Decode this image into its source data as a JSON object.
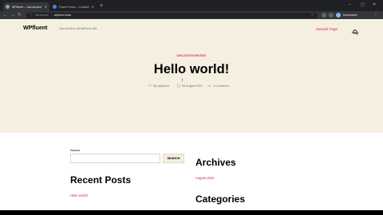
{
  "browser": {
    "tabs": [
      {
        "label": "WPfluent – Just another WordPress",
        "active": true
      },
      {
        "label": "Fluent Forms – Contact Form by WPManageNinja",
        "active": false
      }
    ],
    "new_tab": "+",
    "window_controls": [
      "–",
      "▢",
      "✕"
    ],
    "nav": {
      "back": "←",
      "forward": "→",
      "reload": "↻"
    },
    "address": {
      "secure_label": "Not secure",
      "separator": "|",
      "url": "wpfluent.local"
    },
    "profile_label": "Bookmarks"
  },
  "site": {
    "title": "WPfluent",
    "description": "Just another WordPress site",
    "menu_item": "Sample Page",
    "search_label": "Search"
  },
  "post": {
    "category": "UNCATEGORIZED",
    "title": "Hello world!",
    "author": "By wpfluent",
    "date": "26 August 2021",
    "comments": "1 Comment"
  },
  "widgets": {
    "search_label": "Search",
    "search_value": "",
    "search_button": "SEARCH",
    "recent_posts_heading": "Recent Posts",
    "recent_post_link": "Hello world!",
    "archives_heading": "Archives",
    "archive_link": "August 2021",
    "categories_heading": "Categories"
  },
  "colors": {
    "accent": "#cd2653",
    "hero_bg": "#f5efe0",
    "content_bg": "#ffffff",
    "chrome_dark": "#202124"
  }
}
